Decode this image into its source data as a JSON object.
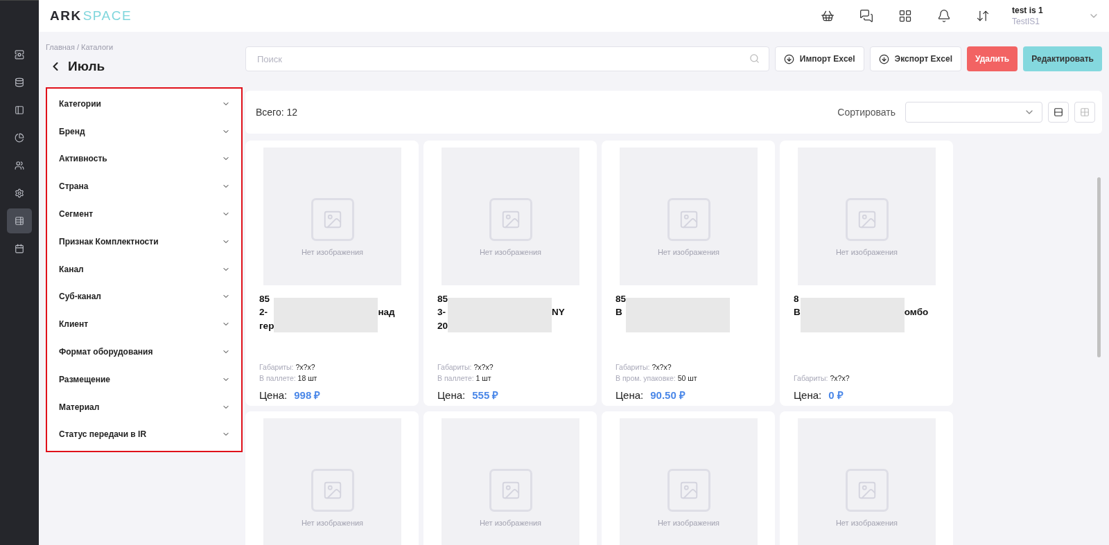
{
  "sidebar": {
    "items": [
      {
        "kind": "servers",
        "selected": false
      },
      {
        "kind": "database",
        "selected": false
      },
      {
        "kind": "panel",
        "selected": false
      },
      {
        "kind": "chart",
        "selected": false
      },
      {
        "kind": "users",
        "selected": false
      },
      {
        "kind": "settings",
        "selected": false
      },
      {
        "kind": "catalog",
        "selected": true
      },
      {
        "kind": "calendar",
        "selected": false
      }
    ]
  },
  "header": {
    "logo": {
      "strong": "ARK",
      "light": "SPACE"
    },
    "user": {
      "name": "test is 1",
      "login": "TestIS1"
    }
  },
  "breadcrumb": "Главная / Каталоги",
  "page_title": "Июль",
  "filters": [
    {
      "label": "Категории",
      "expanded": false
    },
    {
      "label": "Бренд",
      "expanded": false
    },
    {
      "label": "Активность",
      "expanded": false
    },
    {
      "label": "Страна",
      "expanded": false
    },
    {
      "label": "Сегмент",
      "expanded": false
    },
    {
      "label": "Признак Комплектности",
      "expanded": false
    },
    {
      "label": "Канал",
      "expanded": false
    },
    {
      "label": "Суб-канал",
      "expanded": false
    },
    {
      "label": "Клиент",
      "expanded": false
    },
    {
      "label": "Формат оборудования",
      "expanded": false
    },
    {
      "label": "Размещение",
      "expanded": false
    },
    {
      "label": "Материал",
      "expanded": false
    },
    {
      "label": "Статус передачи в IR",
      "expanded": false
    }
  ],
  "toolbar": {
    "search": {
      "placeholder": "Поиск"
    },
    "buttons": [
      {
        "kind": "outline",
        "label": "Импорт Excel"
      },
      {
        "kind": "outline",
        "label": "Экспорт Excel"
      },
      {
        "kind": "danger",
        "label": "Удалить"
      },
      {
        "kind": "primary",
        "label": "Редактировать"
      }
    ]
  },
  "summary": {
    "total": "Всего: 12",
    "sort_label": "Сортировать",
    "views": [
      {
        "kind": "list",
        "selected": true
      },
      {
        "kind": "grid",
        "selected": false
      }
    ]
  },
  "products": [
    {
      "placeholder": "Нет изображения",
      "title_lines": [
        {
          "before": "85"
        },
        {
          "before": "2-",
          "after": "над"
        },
        {
          "before": "гер"
        }
      ],
      "redacted": true,
      "specs": [
        {
          "label": "Габариты:",
          "value": "?x?x?"
        },
        {
          "label": "В паллете:",
          "value": "18 шт"
        }
      ],
      "price_label": "Цена:",
      "price": "998 ₽"
    },
    {
      "placeholder": "Нет изображения",
      "title_lines": [
        {
          "before": "85"
        },
        {
          "before": "3-",
          "after": "NY"
        },
        {
          "before": "20"
        }
      ],
      "redacted": true,
      "specs": [
        {
          "label": "Габариты:",
          "value": "?x?x?"
        },
        {
          "label": "В паллете:",
          "value": "1 шт"
        }
      ],
      "price_label": "Цена:",
      "price": "555 ₽"
    },
    {
      "placeholder": "Нет изображения",
      "title_lines": [
        {
          "before": "85"
        },
        {
          "before": "B"
        }
      ],
      "redacted": true,
      "specs": [
        {
          "label": "Габариты:",
          "value": "?x?x?"
        },
        {
          "label": "В пром. упаковке:",
          "value": "50 шт"
        }
      ],
      "price_label": "Цена:",
      "price": "90.50 ₽"
    },
    {
      "placeholder": "Нет изображения",
      "title_lines": [
        {
          "before": "8"
        },
        {
          "before": "B",
          "after": "омбо"
        }
      ],
      "redacted": true,
      "specs": [
        {
          "label": "Габариты:",
          "value": "?x?x?"
        }
      ],
      "price_label": "Цена:",
      "price": "0 ₽"
    },
    {
      "placeholder": "Нет изображения"
    },
    {
      "placeholder": "Нет изображения"
    },
    {
      "placeholder": "Нет изображения"
    },
    {
      "placeholder": "Нет изображения"
    }
  ]
}
